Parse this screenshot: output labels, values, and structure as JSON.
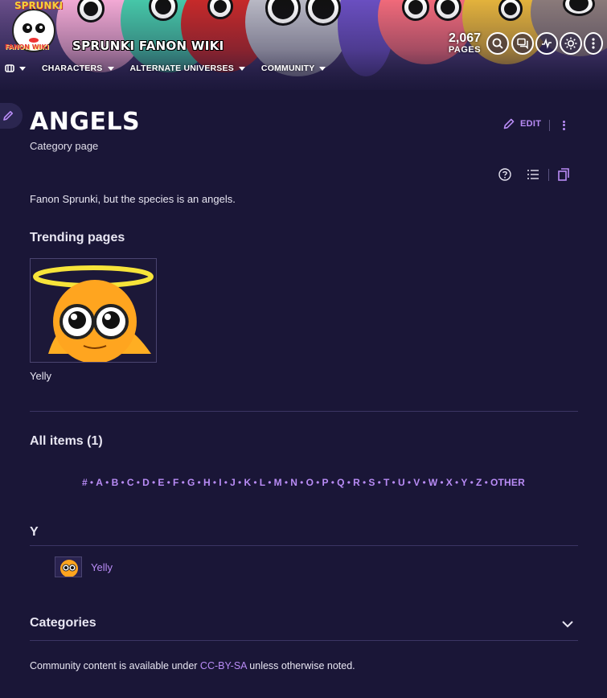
{
  "wiki": {
    "name": "SPRUNKI FANON WIKI",
    "logo_text_top": "SPRUNKI",
    "logo_text_bottom": "FANON WIKI",
    "pages_count": "2,067",
    "pages_label": "PAGES"
  },
  "nav": {
    "items": [
      {
        "label": "CHARACTERS"
      },
      {
        "label": "ALTERNATE UNIVERSES"
      },
      {
        "label": "COMMUNITY"
      }
    ]
  },
  "page": {
    "title": "ANGELS",
    "subtitle": "Category page",
    "edit_label": "EDIT",
    "description": "Fanon Sprunki, but the species is an angels."
  },
  "trending": {
    "heading": "Trending pages",
    "items": [
      {
        "label": "Yelly"
      }
    ]
  },
  "all_items": {
    "heading": "All items (1)",
    "alphabet": [
      "#",
      "A",
      "B",
      "C",
      "D",
      "E",
      "F",
      "G",
      "H",
      "I",
      "J",
      "K",
      "L",
      "M",
      "N",
      "O",
      "P",
      "Q",
      "R",
      "S",
      "T",
      "U",
      "V",
      "W",
      "X",
      "Y",
      "Z",
      "OTHER"
    ],
    "groups": [
      {
        "letter": "Y",
        "items": [
          {
            "label": "Yelly"
          }
        ]
      }
    ]
  },
  "categories": {
    "heading": "Categories"
  },
  "footer": {
    "license_prefix": "Community content is available under ",
    "license_link": "CC-BY-SA",
    "license_suffix": " unless otherwise noted."
  },
  "colors": {
    "background": "#1a1637",
    "accent": "#b98cf6",
    "divider": "#3b3563"
  },
  "icons": [
    "fandom-icon",
    "search-icon",
    "discussions-icon",
    "activity-icon",
    "theme-toggle-icon",
    "more-icon",
    "pencil-icon",
    "help-icon",
    "toc-icon",
    "copy-icon",
    "chevron-down-icon"
  ]
}
